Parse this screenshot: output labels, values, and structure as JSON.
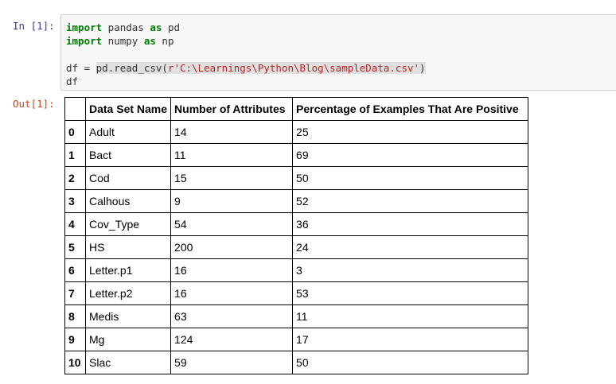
{
  "input_prompt": "In [1]:",
  "output_prompt": "Out[1]:",
  "code": {
    "line1": {
      "kw1": "import",
      "mod": " pandas ",
      "kw2": "as",
      "alias": " pd"
    },
    "line2": {
      "kw1": "import",
      "mod": " numpy ",
      "kw2": "as",
      "alias": " np"
    },
    "line4": {
      "pre": "df = ",
      "call": "pd.read_csv(",
      "str": "r'C:\\Learnings\\Python\\Blog\\sampleData.csv'",
      "close": ")"
    },
    "line5": "df"
  },
  "table": {
    "columns": [
      "",
      "Data Set Name",
      "Number of Attributes",
      "Percentage of Examples That Are Positive"
    ],
    "rows": [
      [
        "0",
        "Adult",
        "14",
        "25"
      ],
      [
        "1",
        "Bact",
        "11",
        "69"
      ],
      [
        "2",
        "Cod",
        "15",
        "50"
      ],
      [
        "3",
        "Calhous",
        "9",
        "52"
      ],
      [
        "4",
        "Cov_Type",
        "54",
        "36"
      ],
      [
        "5",
        "HS",
        "200",
        "24"
      ],
      [
        "6",
        "Letter.p1",
        "16",
        "3"
      ],
      [
        "7",
        "Letter.p2",
        "16",
        "53"
      ],
      [
        "8",
        "Medis",
        "63",
        "11"
      ],
      [
        "9",
        "Mg",
        "124",
        "17"
      ],
      [
        "10",
        "Slac",
        "59",
        "50"
      ]
    ]
  }
}
